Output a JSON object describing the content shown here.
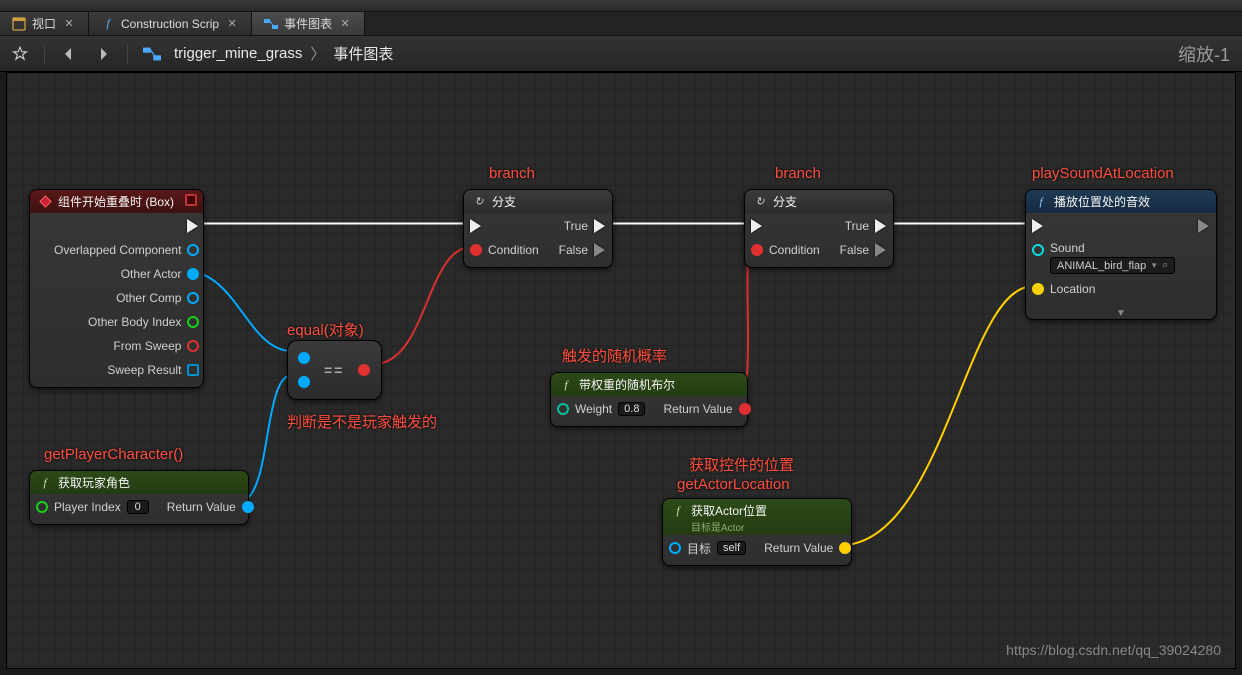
{
  "tabs": [
    {
      "label": "视口",
      "icon": "viewport"
    },
    {
      "label": "Construction Scrip",
      "icon": "function"
    },
    {
      "label": "事件图表",
      "icon": "graph"
    }
  ],
  "breadcrumb": {
    "item1": "trigger_mine_grass",
    "sep": "〉",
    "item2": "事件图表"
  },
  "zoom": "缩放-1",
  "annotations": {
    "branch1": "branch",
    "branch2": "branch",
    "playSound": "playSoundAtLocation",
    "equal": "equal(对象)",
    "equalDesc": "判断是不是玩家触发的",
    "getPlayer": "getPlayerCharacter()",
    "randomProb": "触发的随机概率",
    "getLoc1": "获取控件的位置",
    "getLoc2": "getActorLocation"
  },
  "nodes": {
    "event": {
      "title": "组件开始重叠时 (Box)",
      "pins": {
        "overlapped": "Overlapped Component",
        "otherActor": "Other Actor",
        "otherComp": "Other Comp",
        "otherBody": "Other Body Index",
        "fromSweep": "From Sweep",
        "sweepResult": "Sweep Result"
      }
    },
    "equal": {
      "symbol": "=="
    },
    "getPlayer": {
      "title": "获取玩家角色",
      "playerIndex": "Player Index",
      "playerIndexVal": "0",
      "return": "Return Value"
    },
    "branch1": {
      "title": "分支",
      "condition": "Condition",
      "true": "True",
      "false": "False"
    },
    "branch2": {
      "title": "分支",
      "condition": "Condition",
      "true": "True",
      "false": "False"
    },
    "randomBool": {
      "title": "带权重的随机布尔",
      "weight": "Weight",
      "weightVal": "0.8",
      "return": "Return Value"
    },
    "getActorLoc": {
      "title": "获取Actor位置",
      "subtitle": "目标是Actor",
      "target": "目标",
      "targetVal": "self",
      "return": "Return Value"
    },
    "playSound": {
      "title": "播放位置处的音效",
      "sound": "Sound",
      "soundVal": "ANIMAL_bird_flap",
      "location": "Location"
    }
  },
  "watermark": "https://blog.csdn.net/qq_39024280"
}
